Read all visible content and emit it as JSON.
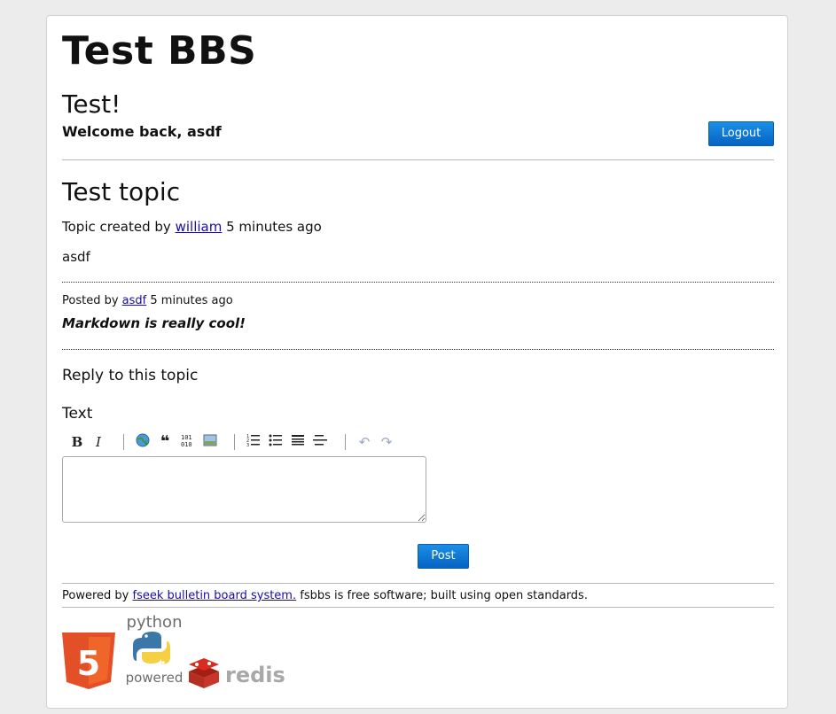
{
  "site": {
    "title": "Test BBS",
    "subtitle": "Test!"
  },
  "user_bar": {
    "welcome": "Welcome back, asdf",
    "logout_label": "Logout"
  },
  "topic": {
    "title": "Test topic",
    "meta_prefix": "Topic created by",
    "author": "william",
    "meta_suffix": "5 minutes ago",
    "body": "asdf"
  },
  "posts": [
    {
      "prefix": "Posted by",
      "author": "asdf",
      "time": "5 minutes ago",
      "body": "Markdown is really cool!"
    }
  ],
  "reply": {
    "heading": "Reply to this topic",
    "text_label": "Text",
    "toolbar": [
      {
        "name": "bold-icon",
        "glyph": "B"
      },
      {
        "name": "italic-icon",
        "glyph": "I"
      },
      {
        "name": "link-icon",
        "glyph": ""
      },
      {
        "name": "quote-icon",
        "glyph": "❝"
      },
      {
        "name": "code-icon",
        "glyph": ""
      },
      {
        "name": "image-icon",
        "glyph": ""
      },
      {
        "name": "ordered-list-icon",
        "glyph": ""
      },
      {
        "name": "bullet-list-icon",
        "glyph": ""
      },
      {
        "name": "heading-icon",
        "glyph": ""
      },
      {
        "name": "horizontal-rule-icon",
        "glyph": ""
      },
      {
        "name": "undo-icon",
        "glyph": "↶"
      },
      {
        "name": "redo-icon",
        "glyph": "↷"
      }
    ],
    "text_value": "",
    "post_label": "Post"
  },
  "footer": {
    "powered_prefix": "Powered by",
    "link_text": "fseek bulletin board system.",
    "suffix": "fsbbs is free software; built using open standards.",
    "badges": {
      "html5": "5",
      "python_top": "python",
      "python_bottom": "powered",
      "redis": "redis"
    }
  },
  "colors": {
    "accent": "#0a6fd4",
    "html5": "#e34f26",
    "python_blue": "#3b77a8",
    "python_yellow": "#f5d042",
    "redis_red": "#d82c20"
  }
}
